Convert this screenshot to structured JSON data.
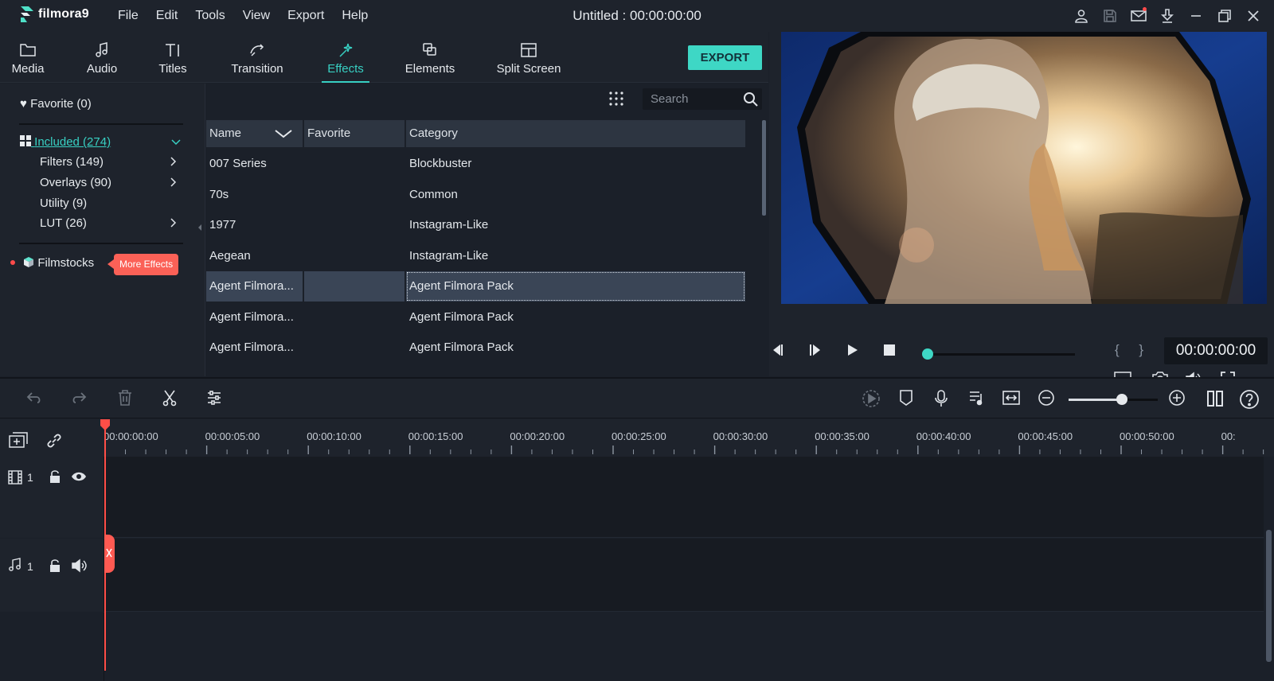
{
  "app": {
    "logo_text": "filmora9",
    "document_title": "Untitled : 00:00:00:00",
    "menu": [
      "File",
      "Edit",
      "Tools",
      "View",
      "Export",
      "Help"
    ],
    "title_icons": [
      "account-icon",
      "save-icon",
      "mail-icon",
      "download-icon",
      "minimize-icon",
      "restore-icon",
      "close-icon"
    ]
  },
  "tabs": [
    {
      "label": "Media",
      "icon": "folder-icon"
    },
    {
      "label": "Audio",
      "icon": "music-note-icon"
    },
    {
      "label": "Titles",
      "icon": "text-icon"
    },
    {
      "label": "Transition",
      "icon": "transition-icon"
    },
    {
      "label": "Effects",
      "icon": "effects-icon",
      "active": true
    },
    {
      "label": "Elements",
      "icon": "elements-icon"
    },
    {
      "label": "Split Screen",
      "icon": "split-screen-icon"
    }
  ],
  "export_label": "EXPORT",
  "sidebar": {
    "favorite": "Favorite (0)",
    "included": "Included (274)",
    "items": [
      "Filters (149)",
      "Overlays (90)",
      "Utility (9)",
      "LUT (26)"
    ],
    "filmstocks": "Filmstocks",
    "more_effects": "More Effects"
  },
  "search": {
    "placeholder": "Search",
    "value": ""
  },
  "table": {
    "columns": [
      "Name",
      "Favorite",
      "Category"
    ],
    "rows": [
      {
        "name": "007 Series",
        "favorite": "",
        "category": "Blockbuster"
      },
      {
        "name": "70s",
        "favorite": "",
        "category": "Common"
      },
      {
        "name": "1977",
        "favorite": "",
        "category": "Instagram-Like"
      },
      {
        "name": "Aegean",
        "favorite": "",
        "category": "Instagram-Like"
      },
      {
        "name": "Agent Filmora...",
        "favorite": "",
        "category": "Agent Filmora Pack",
        "selected": true
      },
      {
        "name": "Agent Filmora...",
        "favorite": "",
        "category": "Agent Filmora Pack"
      },
      {
        "name": "Agent Filmora...",
        "favorite": "",
        "category": "Agent Filmora Pack"
      }
    ]
  },
  "preview": {
    "timecode": "00:00:00:00",
    "braces": "{ }",
    "progress": 0
  },
  "timeline": {
    "ruler_labels": [
      "00:00:00:00",
      "00:00:05:00",
      "00:00:10:00",
      "00:00:15:00",
      "00:00:20:00",
      "00:00:25:00",
      "00:00:30:00",
      "00:00:35:00",
      "00:00:40:00",
      "00:00:45:00",
      "00:00:50:00",
      "00:"
    ],
    "zoom_level": 0.6,
    "tracks": [
      {
        "type": "video",
        "number": "1"
      },
      {
        "type": "audio",
        "number": "1"
      }
    ]
  },
  "colors": {
    "accent": "#3ed7c5",
    "playhead": "#ff4e47",
    "badge": "#fb6157"
  }
}
